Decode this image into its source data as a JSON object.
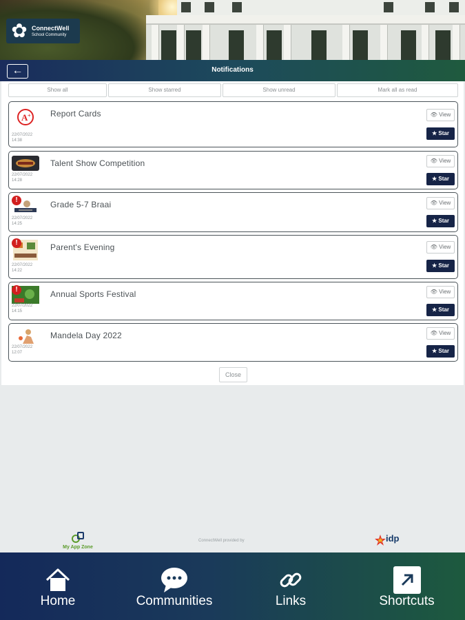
{
  "header": {
    "logo_line1": "ConnectWell",
    "logo_line2": "School Community",
    "title": "Notifications"
  },
  "filters": [
    "Show all",
    "Show starred",
    "Show unread",
    "Mark all as read"
  ],
  "notifications": [
    {
      "title": "Report Cards",
      "date": "22/07/2022",
      "time": "14:38",
      "view": "View",
      "star": "Star",
      "alert": false,
      "icon": "report-card-icon"
    },
    {
      "title": "Talent Show Competition",
      "date": "22/07/2022",
      "time": "14:28",
      "view": "View",
      "star": "Star",
      "alert": false,
      "icon": "talent-show-icon"
    },
    {
      "title": "Grade 5-7 Braai",
      "date": "22/07/2022",
      "time": "14:25",
      "view": "View",
      "star": "Star",
      "alert": true,
      "icon": "braai-icon"
    },
    {
      "title": "Parent's Evening",
      "date": "22/07/2022",
      "time": "14:22",
      "view": "View",
      "star": "Star",
      "alert": true,
      "icon": "parents-evening-icon"
    },
    {
      "title": "Annual Sports Festival",
      "date": "22/07/2022",
      "time": "14:15",
      "view": "View",
      "star": "Star",
      "alert": true,
      "icon": "sports-festival-icon"
    },
    {
      "title": "Mandela Day 2022",
      "date": "22/07/2022",
      "time": "12:07",
      "view": "View",
      "star": "Star",
      "alert": false,
      "icon": "mandela-day-icon"
    }
  ],
  "close_label": "Close",
  "footer": {
    "app_zone": "My App Zone",
    "provided_by": "ConnectWell provided by",
    "idp": "idp"
  },
  "nav": [
    {
      "label": "Home",
      "icon": "home-icon"
    },
    {
      "label": "Communities",
      "icon": "chat-bubble-icon"
    },
    {
      "label": "Links",
      "icon": "link-icon"
    },
    {
      "label": "Shortcuts",
      "icon": "external-arrow-icon"
    }
  ],
  "colors": {
    "nav_dark": "#14295a",
    "nav_green": "#1d5a3e",
    "star_button": "#162447",
    "alert_red": "#d21f1f",
    "app_zone_green": "#5b9b2a"
  }
}
